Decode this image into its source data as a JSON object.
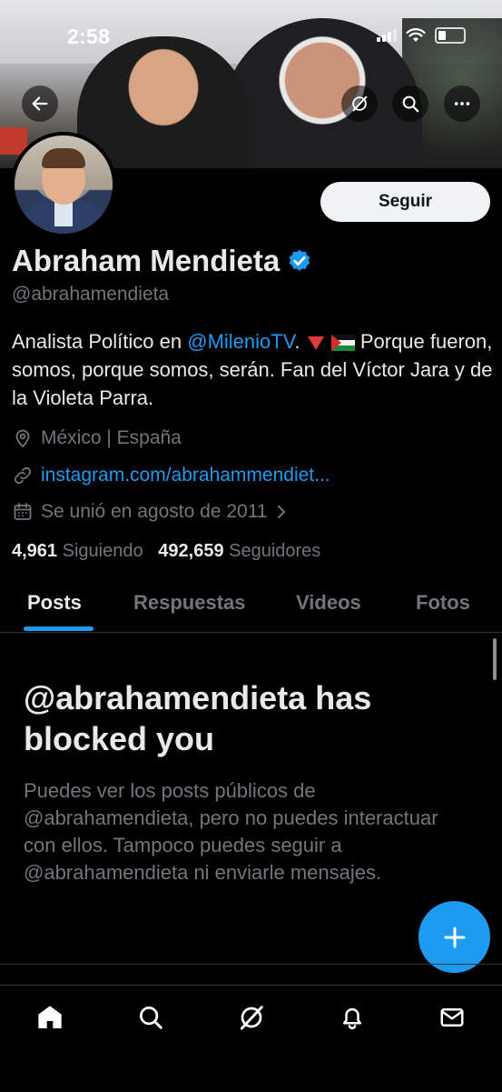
{
  "status_bar": {
    "time": "2:58"
  },
  "profile": {
    "name": "Abraham Mendieta",
    "handle": "@abrahamendieta",
    "follow_label": "Seguir",
    "verified": true
  },
  "bio": {
    "prefix": "Analista Político en ",
    "mention": "@MilenioTV",
    "suffix_1": ". ",
    "suffix_2": " Porque fueron, somos, porque somos, serán. Fan del Víctor Jara y de la Violeta Parra."
  },
  "meta": {
    "location": "México | España",
    "website": "instagram.com/abrahammendiet...",
    "joined": "Se unió en agosto de 2011"
  },
  "counts": {
    "following_value": "4,961",
    "following_label": "Siguiendo",
    "followers_value": "492,659",
    "followers_label": "Seguidores"
  },
  "tabs": [
    "Posts",
    "Respuestas",
    "Videos",
    "Fotos"
  ],
  "blocked": {
    "title": "@abrahamendieta has blocked you",
    "text": "Puedes ver los posts públicos de @abrahamendieta, pero no puedes interactuar con ellos. Tampoco puedes seguir a @abrahamendieta ni enviarle mensajes."
  },
  "colors": {
    "accent": "#1d9bf0",
    "background": "#000000",
    "text": "#e7e9ea",
    "muted": "#71767b"
  },
  "icons": {
    "header": [
      "back-arrow-icon",
      "grok-icon",
      "search-icon",
      "more-icon"
    ],
    "nav": [
      "home-icon",
      "search-icon",
      "grok-icon",
      "notifications-icon",
      "messages-icon"
    ],
    "fab": "plus-icon"
  }
}
